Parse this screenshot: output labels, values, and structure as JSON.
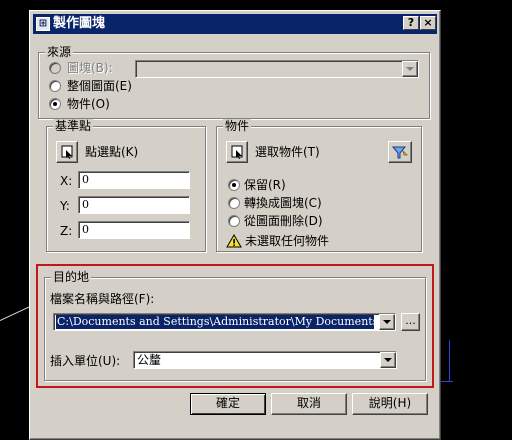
{
  "dialog": {
    "title": "製作圖塊",
    "help_button": "?",
    "close_button": "×"
  },
  "source": {
    "legend": "來源",
    "options": [
      {
        "label": "圖塊(B):",
        "selected": false,
        "enabled": false
      },
      {
        "label": "整個圖面(E)",
        "selected": false,
        "enabled": true
      },
      {
        "label": "物件(O)",
        "selected": true,
        "enabled": true
      }
    ],
    "block_dropdown_value": ""
  },
  "base_point": {
    "legend": "基準點",
    "pick_button": "點選點(K)",
    "x_label": "X:",
    "x_value": "0",
    "y_label": "Y:",
    "y_value": "0",
    "z_label": "Z:",
    "z_value": "0"
  },
  "objects": {
    "legend": "物件",
    "select_button": "選取物件(T)",
    "options": [
      {
        "label": "保留(R)",
        "selected": true
      },
      {
        "label": "轉換成圖塊(C)",
        "selected": false
      },
      {
        "label": "從圖面刪除(D)",
        "selected": false
      }
    ],
    "warning": "未選取任何物件"
  },
  "destination": {
    "legend": "目的地",
    "path_label": "檔案名稱與路徑(F):",
    "path_value": "C:\\Documents and Settings\\Administrator\\My Documents\\new block",
    "browse_button": "...",
    "units_label": "插入單位(U):",
    "units_value": "公釐"
  },
  "buttons": {
    "ok": "確定",
    "cancel": "取消",
    "help": "說明(H)"
  },
  "colors": {
    "title_bar": "#0a246a",
    "highlight": "#c01818",
    "dialog_face": "#d4d0c8",
    "selection": "#0a246a"
  }
}
